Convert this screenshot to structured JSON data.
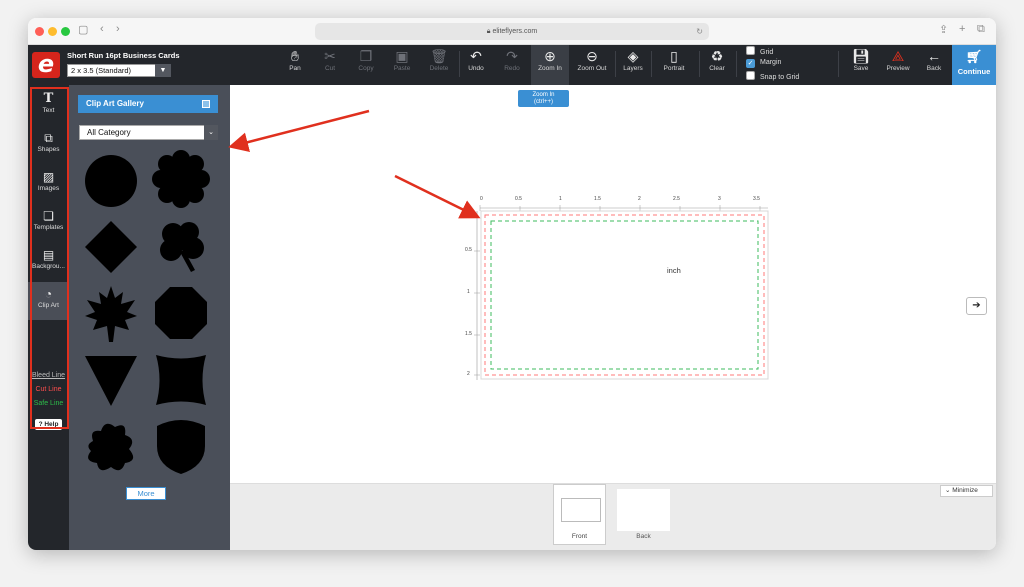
{
  "browser": {
    "url": "eliteflyers.com",
    "traffic_colors": [
      "#ff5f57",
      "#febc2e",
      "#28c840"
    ]
  },
  "app": {
    "logo_letter": "e",
    "product_title": "Short Run 16pt Business Cards",
    "size_selected": "2 x 3.5 (Standard)",
    "brand_color": "#d6251c",
    "accent_color": "#3a8fd3"
  },
  "toolbar": {
    "pan": "Pan",
    "cut": "Cut",
    "copy": "Copy",
    "paste": "Paste",
    "delete": "Delete",
    "undo": "Undo",
    "redo": "Redo",
    "zoom_in": "Zoom In",
    "zoom_out": "Zoom Out",
    "layers": "Layers",
    "portrait": "Portrait",
    "clear": "Clear",
    "grid": "Grid",
    "margin": "Margin",
    "snap": "Snap to Grid",
    "save": "Save",
    "preview": "Preview",
    "back": "Back",
    "continue": "Continue",
    "grid_checked": false,
    "margin_checked": true,
    "snap_checked": false
  },
  "tooltip": {
    "line1": "Zoom In",
    "line2": "(ctrl++)"
  },
  "rail": {
    "text": "Text",
    "shapes": "Shapes",
    "images": "Images",
    "templates": "Templates",
    "background": "Backgrou...",
    "clipart": "Clip Art",
    "bleed": "Bleed Line",
    "cut": "Cut Line",
    "safe": "Safe Line",
    "help": "? Help"
  },
  "panel": {
    "gallery_title": "Clip Art Gallery",
    "category": "All Category",
    "more": "More",
    "shapes": [
      "circle",
      "scallop-flower",
      "diamond",
      "clover",
      "leaf",
      "octagon",
      "triangle-down",
      "pillow-square",
      "splat",
      "shield"
    ]
  },
  "canvas": {
    "unit": "inch",
    "h_ticks": [
      "0",
      "0.5",
      "1",
      "1.5",
      "2",
      "2.5",
      "3",
      "3.5"
    ],
    "v_ticks": [
      "0.5",
      "1",
      "1.5",
      "2"
    ]
  },
  "pages": {
    "front": "Front",
    "back": "Back",
    "minimize": "Minimize"
  }
}
